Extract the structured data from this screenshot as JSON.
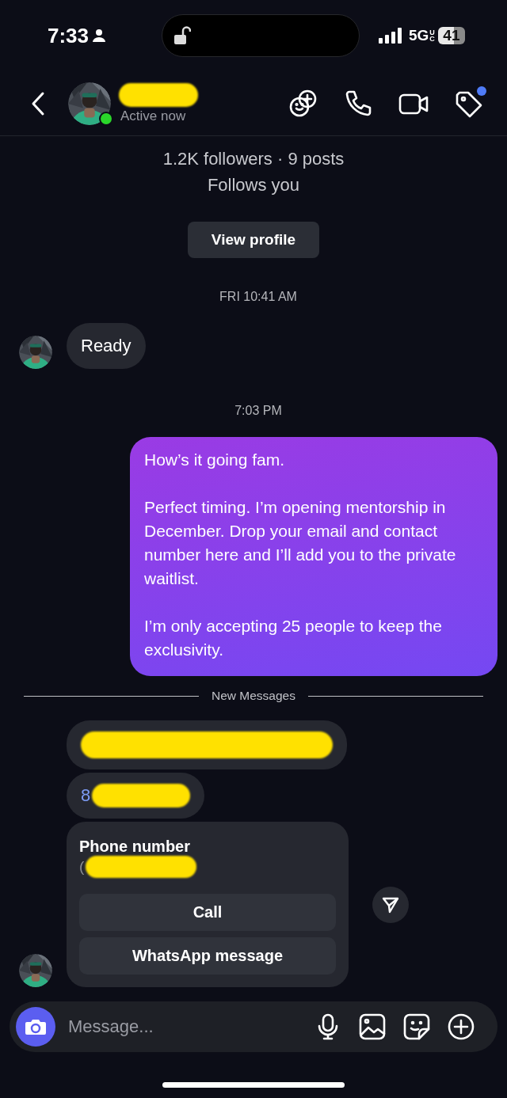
{
  "status_bar": {
    "time": "7:33",
    "network": "5G",
    "network_suffix": "UC",
    "battery": "41"
  },
  "header": {
    "name_redacted": true,
    "active_status": "Active now",
    "online": true,
    "tag_badge": true
  },
  "profile": {
    "stats": "1.2K followers · 9 posts",
    "relation": "Follows you",
    "button": "View profile"
  },
  "messages": [
    {
      "kind": "timestamp",
      "text": "FRI 10:41 AM"
    },
    {
      "kind": "received",
      "text": "Ready",
      "avatar": true
    },
    {
      "kind": "timestamp",
      "text": "7:03 PM"
    },
    {
      "kind": "sent",
      "paragraphs": [
        "How’s it going fam.",
        "Perfect timing. I’m opening mentorship in December. Drop your email and contact number here and I’ll add you to the private waitlist.",
        "I’m only accepting 25 people to keep the exclusivity."
      ]
    },
    {
      "kind": "divider",
      "text": "New Messages"
    },
    {
      "kind": "received",
      "redacted": true,
      "avatar": false
    },
    {
      "kind": "received",
      "text": "8",
      "link": true,
      "redacted": true,
      "avatar": false
    },
    {
      "kind": "contact-card",
      "title": "Phone number",
      "value": "(",
      "redacted": true,
      "actions": [
        "Call",
        "WhatsApp message"
      ],
      "avatar": true,
      "share": true
    }
  ],
  "composer": {
    "placeholder": "Message..."
  }
}
